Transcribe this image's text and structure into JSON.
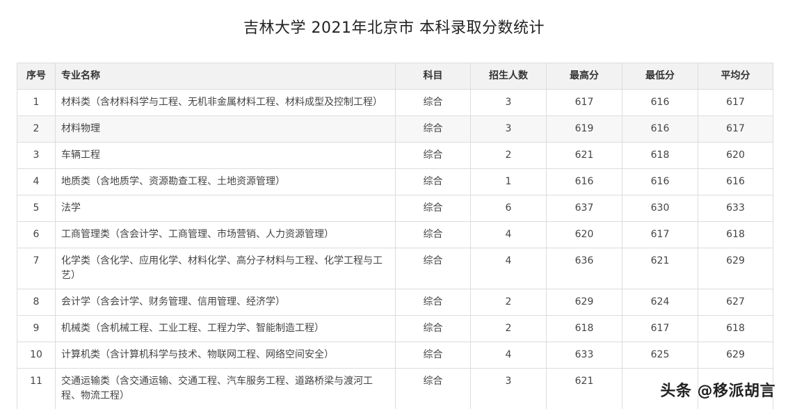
{
  "title": "吉林大学 2021年北京市 本科录取分数统计",
  "headers": {
    "seq": "序号",
    "major": "专业名称",
    "subject": "科目",
    "enroll": "招生人数",
    "max": "最高分",
    "min": "最低分",
    "avg": "平均分"
  },
  "rows": [
    {
      "seq": "1",
      "major": "材料类（含材料科学与工程、无机非金属材料工程、材料成型及控制工程）",
      "subject": "综合",
      "enroll": "3",
      "max": "617",
      "min": "616",
      "avg": "617"
    },
    {
      "seq": "2",
      "major": "材料物理",
      "subject": "综合",
      "enroll": "3",
      "max": "619",
      "min": "616",
      "avg": "617"
    },
    {
      "seq": "3",
      "major": "车辆工程",
      "subject": "综合",
      "enroll": "2",
      "max": "621",
      "min": "618",
      "avg": "620"
    },
    {
      "seq": "4",
      "major": "地质类（含地质学、资源勘查工程、土地资源管理）",
      "subject": "综合",
      "enroll": "1",
      "max": "616",
      "min": "616",
      "avg": "616"
    },
    {
      "seq": "5",
      "major": "法学",
      "subject": "综合",
      "enroll": "6",
      "max": "637",
      "min": "630",
      "avg": "633"
    },
    {
      "seq": "6",
      "major": "工商管理类（含会计学、工商管理、市场营销、人力资源管理）",
      "subject": "综合",
      "enroll": "4",
      "max": "620",
      "min": "617",
      "avg": "618"
    },
    {
      "seq": "7",
      "major": "化学类（含化学、应用化学、材料化学、高分子材料与工程、化学工程与工艺）",
      "subject": "综合",
      "enroll": "4",
      "max": "636",
      "min": "621",
      "avg": "629"
    },
    {
      "seq": "8",
      "major": "会计学（含会计学、财务管理、信用管理、经济学）",
      "subject": "综合",
      "enroll": "2",
      "max": "629",
      "min": "624",
      "avg": "627"
    },
    {
      "seq": "9",
      "major": "机械类（含机械工程、工业工程、工程力学、智能制造工程）",
      "subject": "综合",
      "enroll": "2",
      "max": "618",
      "min": "617",
      "avg": "618"
    },
    {
      "seq": "10",
      "major": "计算机类（含计算机科学与技术、物联网工程、网络空间安全）",
      "subject": "综合",
      "enroll": "4",
      "max": "633",
      "min": "625",
      "avg": "629"
    },
    {
      "seq": "11",
      "major": "交通运输类（含交通运输、交通工程、汽车服务工程、道路桥梁与渡河工程、物流工程）",
      "subject": "综合",
      "enroll": "3",
      "max": "621",
      "min": "",
      "avg": ""
    }
  ],
  "watermark": "头条 @移派胡言"
}
